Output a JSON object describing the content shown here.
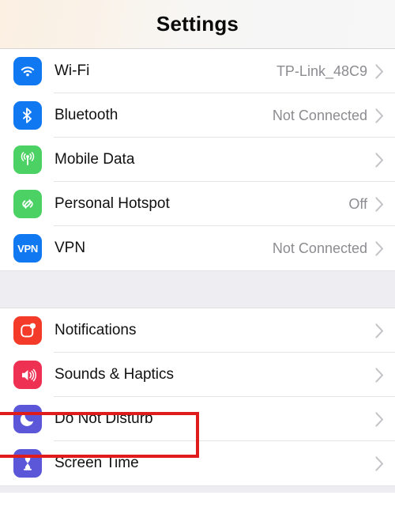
{
  "header": {
    "title": "Settings"
  },
  "colors": {
    "blue": "#1079f2",
    "green": "#4bd164",
    "red": "#f43a28",
    "pink": "#ee3053",
    "purple": "#5b57d8",
    "value_gray": "#8c8c91",
    "chevron_gray": "#c3c3c7",
    "separator": "#e4e4e6",
    "group_gap": "#eeeef2",
    "highlight": "#e01b1b"
  },
  "groups": [
    {
      "name": "connectivity",
      "rows": [
        {
          "icon": "wifi-icon",
          "icon_color": "#1079f2",
          "label": "Wi-Fi",
          "value": "TP-Link_48C9",
          "chevron": true
        },
        {
          "icon": "bluetooth-icon",
          "icon_color": "#1079f2",
          "label": "Bluetooth",
          "value": "Not Connected",
          "chevron": true
        },
        {
          "icon": "mobile-data-icon",
          "icon_color": "#4bd164",
          "label": "Mobile Data",
          "value": "",
          "chevron": true
        },
        {
          "icon": "personal-hotspot-icon",
          "icon_color": "#4bd164",
          "label": "Personal Hotspot",
          "value": "Off",
          "chevron": true
        },
        {
          "icon": "vpn-icon",
          "icon_color": "#1079f2",
          "label": "VPN",
          "value": "Not Connected",
          "chevron": true
        }
      ]
    },
    {
      "name": "alerts",
      "rows": [
        {
          "icon": "notifications-icon",
          "icon_color": "#f43a28",
          "label": "Notifications",
          "value": "",
          "chevron": true
        },
        {
          "icon": "sounds-icon",
          "icon_color": "#ee3053",
          "label": "Sounds & Haptics",
          "value": "",
          "chevron": true
        },
        {
          "icon": "do-not-disturb-icon",
          "icon_color": "#5b57d8",
          "label": "Do Not Disturb",
          "value": "",
          "chevron": true,
          "highlighted": true
        },
        {
          "icon": "screen-time-icon",
          "icon_color": "#5b57d8",
          "label": "Screen Time",
          "value": "",
          "chevron": true
        }
      ]
    }
  ]
}
